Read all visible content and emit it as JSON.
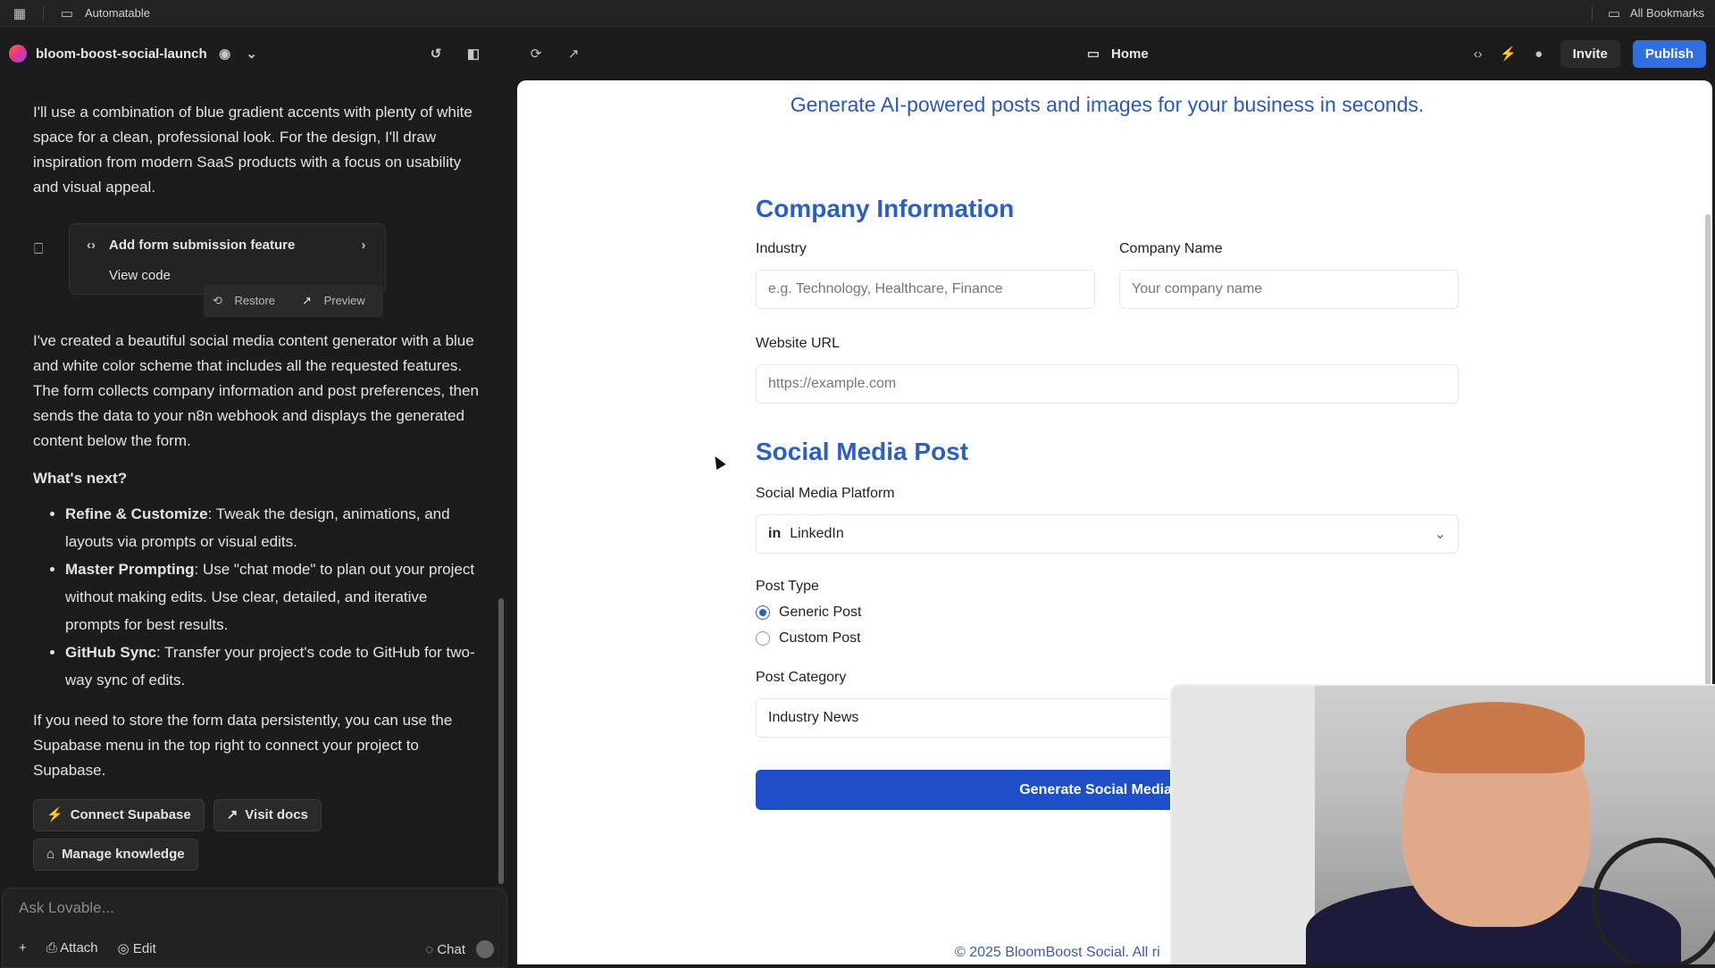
{
  "bookmarks": {
    "left_folder": "Automatable",
    "right_folder": "All Bookmarks"
  },
  "topbar": {
    "project_name": "bloom-boost-social-launch",
    "page": "Home",
    "invite_label": "Invite",
    "publish_label": "Publish"
  },
  "chat": {
    "intro": "I'll use a combination of blue gradient accents with plenty of white space for a clean, professional look. For the design, I'll draw inspiration from modern SaaS products with a focus on usability and visual appeal.",
    "card": {
      "title": "Add form submission feature",
      "view_code": "View code",
      "restore": "Restore",
      "preview": "Preview"
    },
    "summary": "I've created a beautiful social media content generator with a blue and white color scheme that includes all the requested features. The form collects company information and post preferences, then sends the data to your n8n webhook and displays the generated content below the form.",
    "next_heading": "What's next?",
    "items": [
      {
        "bold": "Refine & Customize",
        "text": ": Tweak the design, animations, and layouts via prompts or visual edits."
      },
      {
        "bold": "Master Prompting",
        "text": ": Use \"chat mode\" to plan out your project without making edits. Use clear, detailed, and iterative prompts for best results."
      },
      {
        "bold": "GitHub Sync",
        "text": ": Transfer your project's code to GitHub for two-way sync of edits."
      }
    ],
    "supabase_note": "If you need to store the form data persistently, you can use the Supabase menu in the top right to connect your project to Supabase.",
    "buttons": {
      "connect": "Connect Supabase",
      "docs": "Visit docs",
      "knowledge": "Manage knowledge"
    },
    "composer": {
      "placeholder": "Ask Lovable...",
      "attach": "Attach",
      "edit": "Edit",
      "chat": "Chat"
    }
  },
  "preview": {
    "tagline": "Generate AI-powered posts and images for your business in seconds.",
    "company_section": "Company Information",
    "industry_label": "Industry",
    "industry_placeholder": "e.g. Technology, Healthcare, Finance",
    "company_name_label": "Company Name",
    "company_name_placeholder": "Your company name",
    "website_label": "Website URL",
    "website_placeholder": "https://example.com",
    "social_section": "Social Media Post",
    "platform_label": "Social Media Platform",
    "platform_value": "LinkedIn",
    "post_type_label": "Post Type",
    "post_types": [
      "Generic Post",
      "Custom Post"
    ],
    "post_type_selected": "Generic Post",
    "category_label": "Post Category",
    "category_value": "Industry News",
    "generate_label": "Generate Social Media Co",
    "footer": "© 2025 BloomBoost Social. All ri"
  },
  "colors": {
    "accent": "#2b5fc4",
    "publish": "#2f6fe0",
    "dark_bg": "#1c1c1c"
  }
}
